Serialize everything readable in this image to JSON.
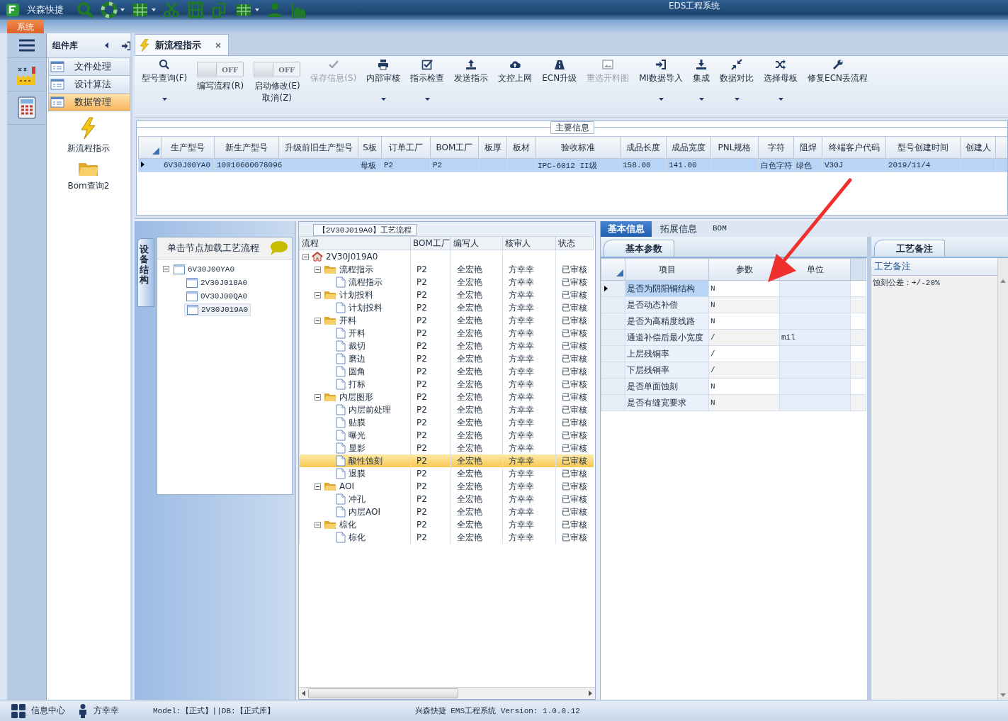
{
  "window": {
    "app_name": "兴森快捷",
    "title": "EDS工程系统"
  },
  "menu_tabs": [
    {
      "label": "系统",
      "selected": true
    }
  ],
  "component_library": {
    "title": "组件库",
    "groups": [
      {
        "label": "文件处理",
        "selected": false
      },
      {
        "label": "设计算法",
        "selected": false
      },
      {
        "label": "数据管理",
        "selected": true
      }
    ],
    "items": [
      {
        "label": "新流程指示",
        "kind": "flash"
      },
      {
        "label": "Bom查询2",
        "kind": "folder"
      }
    ]
  },
  "document_tabs": [
    {
      "label": "新流程指示",
      "selected": true
    }
  ],
  "ribbon": [
    {
      "kind": "button",
      "label": "型号查询(F)",
      "disabled": false,
      "dropdown": true
    },
    {
      "kind": "toggle",
      "label": "编写流程(R)",
      "switch_text": "OFF",
      "on": false
    },
    {
      "kind": "toggle",
      "label": "启动修改(E)\n取消(Z)",
      "switch_text": "OFF",
      "on": false
    },
    {
      "kind": "button",
      "label": "保存信息(S)",
      "disabled": true,
      "dropdown": false
    },
    {
      "kind": "button",
      "label": "内部审核",
      "disabled": false,
      "dropdown": true
    },
    {
      "kind": "button",
      "label": "指示检查",
      "disabled": false,
      "dropdown": true
    },
    {
      "kind": "button",
      "label": "发送指示",
      "disabled": false,
      "dropdown": false
    },
    {
      "kind": "button",
      "label": "文控上网",
      "disabled": false,
      "dropdown": false
    },
    {
      "kind": "button",
      "label": "ECN升级",
      "disabled": false,
      "dropdown": false
    },
    {
      "kind": "button",
      "label": "重选开料图",
      "disabled": true,
      "dropdown": false
    },
    {
      "kind": "button",
      "label": "MI数据导入",
      "disabled": false,
      "dropdown": true
    },
    {
      "kind": "button",
      "label": "集成",
      "disabled": false,
      "dropdown": true
    },
    {
      "kind": "button",
      "label": "数据对比",
      "disabled": false,
      "dropdown": true
    },
    {
      "kind": "button",
      "label": "选择母板",
      "disabled": false,
      "dropdown": true
    },
    {
      "kind": "button",
      "label": "修复ECN丢流程",
      "disabled": false,
      "dropdown": false
    }
  ],
  "main_info": {
    "title": "主要信息",
    "columns": [
      "生产型号",
      "新生产型号",
      "升级前旧生产型号",
      "S板",
      "订单工厂",
      "BOM工厂",
      "板厚",
      "板材",
      "验收标准",
      "成品长度",
      "成品宽度",
      "PNL规格",
      "字符",
      "阻焊",
      "终端客户代码",
      "型号创建时间",
      "创建人"
    ],
    "rows": [
      {
        "selected": true,
        "cells": [
          "6V30J00YA0",
          "10010600078096",
          null,
          "母板",
          "P2",
          "P2",
          null,
          null,
          "IPC-6012 II级",
          "158.00",
          "141.00",
          null,
          "白色字符",
          "绿色",
          "V30J",
          "2019/11/4",
          null
        ]
      }
    ]
  },
  "structure_panel": {
    "side_tab": "设备结构",
    "header": "单击节点加载工艺流程",
    "tree": [
      {
        "label": "6V30J00YA0",
        "expanded": true,
        "selected": false,
        "children": [
          {
            "label": "2V30J018A0",
            "selected": false
          },
          {
            "label": "0V30J00QA0",
            "selected": false
          },
          {
            "label": "2V30J019A0",
            "selected": true
          }
        ]
      }
    ]
  },
  "process_flow": {
    "title": "【2V30J019A0】工艺流程",
    "columns": [
      "流程",
      "BOM工厂",
      "编写人",
      "核审人",
      "状态"
    ],
    "tree": [
      {
        "label": "2V30J019A0",
        "expanded": true,
        "selected": false,
        "children": [
          {
            "label": "流程指示",
            "expanded": true,
            "selected": false,
            "bom": "P2",
            "writer": "全宏艳",
            "reviewer": "方幸幸",
            "status": "已审核",
            "children": [
              {
                "label": "流程指示",
                "selected": false,
                "bom": "P2",
                "writer": "全宏艳",
                "reviewer": "方幸幸",
                "status": "已审核"
              }
            ]
          },
          {
            "label": "计划投料",
            "expanded": true,
            "selected": false,
            "bom": "P2",
            "writer": "全宏艳",
            "reviewer": "方幸幸",
            "status": "已审核",
            "children": [
              {
                "label": "计划投料",
                "selected": false,
                "bom": "P2",
                "writer": "全宏艳",
                "reviewer": "方幸幸",
                "status": "已审核"
              }
            ]
          },
          {
            "label": "开料",
            "expanded": true,
            "selected": false,
            "bom": "P2",
            "writer": "全宏艳",
            "reviewer": "方幸幸",
            "status": "已审核",
            "children": [
              {
                "label": "开料",
                "selected": false,
                "bom": "P2",
                "writer": "全宏艳",
                "reviewer": "方幸幸",
                "status": "已审核"
              },
              {
                "label": "裁切",
                "selected": false,
                "bom": "P2",
                "writer": "全宏艳",
                "reviewer": "方幸幸",
                "status": "已审核"
              },
              {
                "label": "磨边",
                "selected": false,
                "bom": "P2",
                "writer": "全宏艳",
                "reviewer": "方幸幸",
                "status": "已审核"
              },
              {
                "label": "圆角",
                "selected": false,
                "bom": "P2",
                "writer": "全宏艳",
                "reviewer": "方幸幸",
                "status": "已审核"
              },
              {
                "label": "打标",
                "selected": false,
                "bom": "P2",
                "writer": "全宏艳",
                "reviewer": "方幸幸",
                "status": "已审核"
              }
            ]
          },
          {
            "label": "内层图形",
            "expanded": true,
            "selected": false,
            "bom": "P2",
            "writer": "全宏艳",
            "reviewer": "方幸幸",
            "status": "已审核",
            "children": [
              {
                "label": "内层前处理",
                "selected": false,
                "bom": "P2",
                "writer": "全宏艳",
                "reviewer": "方幸幸",
                "status": "已审核"
              },
              {
                "label": "贴膜",
                "selected": false,
                "bom": "P2",
                "writer": "全宏艳",
                "reviewer": "方幸幸",
                "status": "已审核"
              },
              {
                "label": "曝光",
                "selected": false,
                "bom": "P2",
                "writer": "全宏艳",
                "reviewer": "方幸幸",
                "status": "已审核"
              },
              {
                "label": "显影",
                "selected": false,
                "bom": "P2",
                "writer": "全宏艳",
                "reviewer": "方幸幸",
                "status": "已审核"
              },
              {
                "label": "酸性蚀刻",
                "selected": true,
                "bom": "P2",
                "writer": "全宏艳",
                "reviewer": "方幸幸",
                "status": "已审核"
              },
              {
                "label": "退膜",
                "selected": false,
                "bom": "P2",
                "writer": "全宏艳",
                "reviewer": "方幸幸",
                "status": "已审核"
              }
            ]
          },
          {
            "label": "AOI",
            "expanded": true,
            "selected": false,
            "bom": "P2",
            "writer": "全宏艳",
            "reviewer": "方幸幸",
            "status": "已审核",
            "children": [
              {
                "label": "冲孔",
                "selected": false,
                "bom": "P2",
                "writer": "全宏艳",
                "reviewer": "方幸幸",
                "status": "已审核"
              },
              {
                "label": "内层AOI",
                "selected": false,
                "bom": "P2",
                "writer": "全宏艳",
                "reviewer": "方幸幸",
                "status": "已审核"
              }
            ]
          },
          {
            "label": "棕化",
            "expanded": true,
            "selected": false,
            "bom": "P2",
            "writer": "全宏艳",
            "reviewer": "方幸幸",
            "status": "已审核",
            "children": [
              {
                "label": "棕化",
                "selected": false,
                "bom": "P2",
                "writer": "全宏艳",
                "reviewer": "方幸幸",
                "status": "已审核"
              }
            ]
          }
        ]
      }
    ]
  },
  "detail_tabs": [
    {
      "label": "基本信息",
      "selected": true
    },
    {
      "label": "拓展信息",
      "selected": false
    },
    {
      "label": "BOM",
      "selected": false
    }
  ],
  "parameters": {
    "tab": "基本参数",
    "columns": [
      "项目",
      "参数",
      "单位"
    ],
    "rows": [
      {
        "item": "是否为阴阳铜结构",
        "value": "N",
        "selected": true
      },
      {
        "item": "是否动态补偿",
        "value": "N",
        "selected": false
      },
      {
        "item": "是否为高精度线路",
        "value": "N",
        "selected": false
      },
      {
        "item": "通道补偿后最小宽度",
        "value": "/",
        "unit": "mil",
        "selected": false
      },
      {
        "item": "上层残铜率",
        "value": "/",
        "selected": false
      },
      {
        "item": "下层残铜率",
        "value": "/",
        "selected": false
      },
      {
        "item": "是否单面蚀刻",
        "value": "N",
        "selected": false
      },
      {
        "item": "是否有缝宽要求",
        "value": "N",
        "selected": false
      }
    ]
  },
  "process_notes": {
    "tab": "工艺备注",
    "column": "工艺备注",
    "text": "蚀刻公差：+/-20%"
  },
  "status_bar": {
    "info_center": "信息中心",
    "user": "方幸幸",
    "environment": "Model:【正式】||DB:【正式库】",
    "version": "兴森快捷 EMS工程系统 Version: 1.0.0.12"
  }
}
